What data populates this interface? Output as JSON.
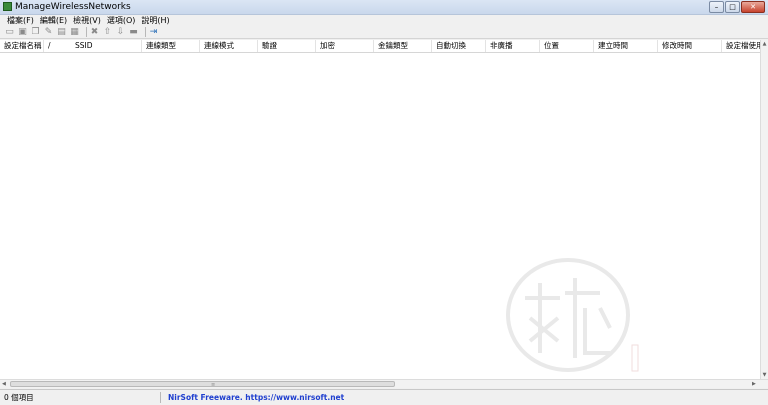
{
  "window": {
    "title": "ManageWirelessNetworks"
  },
  "menu": [
    "檔案(F)",
    "編輯(E)",
    "檢視(V)",
    "選項(O)",
    "說明(H)"
  ],
  "toolbar_icons": [
    "save-icon",
    "export-icon",
    "copy-icon",
    "edit-icon",
    "properties-icon",
    "html-report-icon",
    "delete-icon",
    "move-up-icon",
    "move-down-icon",
    "connect-icon",
    "exit-icon"
  ],
  "columns": [
    "設定檔名稱",
    "/",
    "SSID",
    "連線類型",
    "連線模式",
    "驗證",
    "加密",
    "金鑰類型",
    "自動切換",
    "非廣播",
    "位置",
    "建立時間",
    "修改時間",
    "設定檔使用者"
  ],
  "status": {
    "count": "0 個項目",
    "link": "NirSoft Freeware. https://www.nirsoft.net"
  }
}
